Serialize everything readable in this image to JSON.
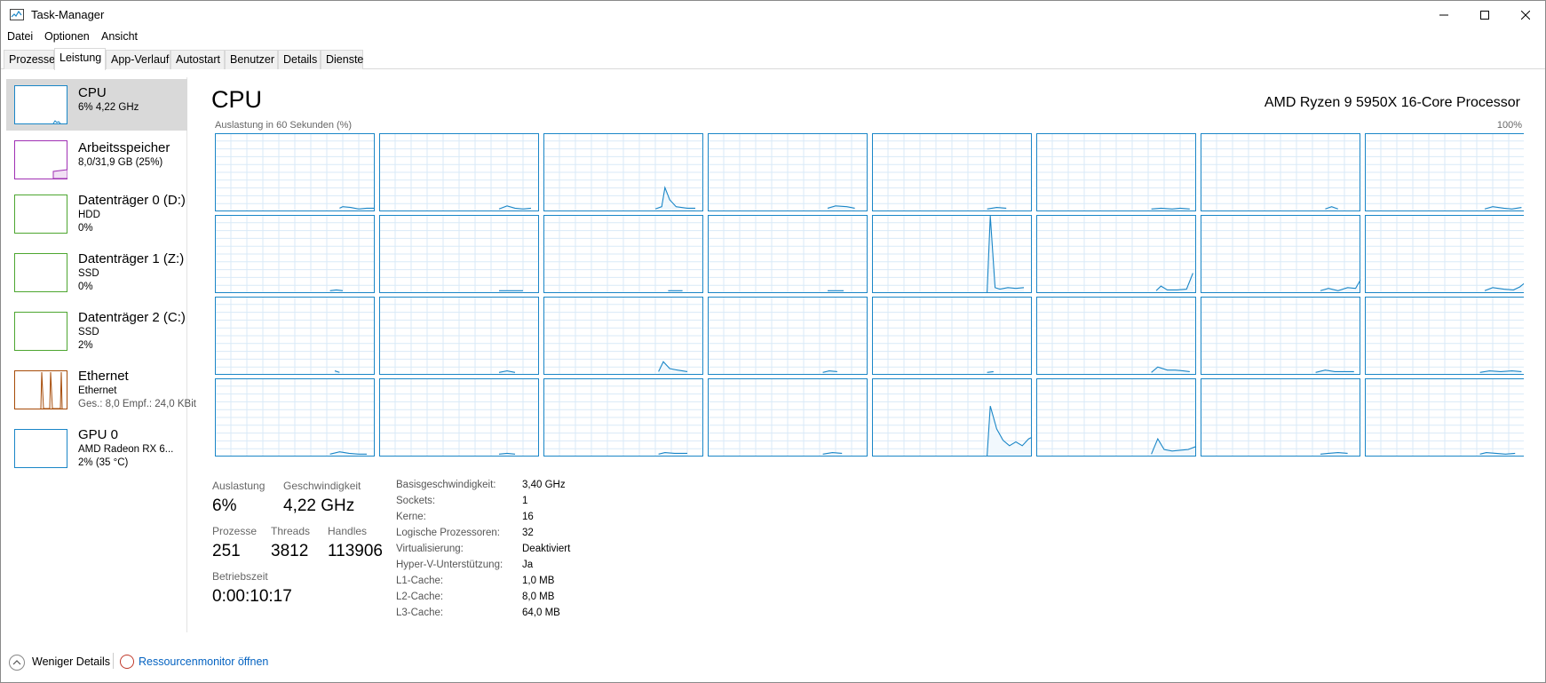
{
  "window": {
    "title": "Task-Manager"
  },
  "menu": {
    "items": [
      "Datei",
      "Optionen",
      "Ansicht"
    ]
  },
  "tabs": [
    {
      "label": "Prozesse",
      "active": false
    },
    {
      "label": "Leistung",
      "active": true
    },
    {
      "label": "App-Verlauf",
      "active": false
    },
    {
      "label": "Autostart",
      "active": false
    },
    {
      "label": "Benutzer",
      "active": false
    },
    {
      "label": "Details",
      "active": false
    },
    {
      "label": "Dienste",
      "active": false
    }
  ],
  "sidebar": {
    "items": [
      {
        "title": "CPU",
        "line1": "6% 4,22 GHz",
        "line2": "",
        "line3": "",
        "color": "#1a86c7",
        "selected": true
      },
      {
        "title": "Arbeitsspeicher",
        "line1": "8,0/31,9 GB (25%)",
        "line2": "",
        "line3": "",
        "color": "#a030b4",
        "selected": false
      },
      {
        "title": "Datenträger 0 (D:)",
        "line1": "HDD",
        "line2": "0%",
        "line3": "",
        "color": "#4da630",
        "selected": false
      },
      {
        "title": "Datenträger 1 (Z:)",
        "line1": "SSD",
        "line2": "0%",
        "line3": "",
        "color": "#4da630",
        "selected": false
      },
      {
        "title": "Datenträger 2 (C:)",
        "line1": "SSD",
        "line2": "2%",
        "line3": "",
        "color": "#4da630",
        "selected": false
      },
      {
        "title": "Ethernet",
        "line1": "Ethernet",
        "line2": "Ges.: 8,0  Empf.: 24,0 KBit",
        "line3": "",
        "color": "#a64b08",
        "selected": false
      },
      {
        "title": "GPU 0",
        "line1": "AMD Radeon RX 6...",
        "line2": "2% (35 °C)",
        "line3": "",
        "color": "#1a86c7",
        "selected": false
      }
    ]
  },
  "main": {
    "title": "CPU",
    "model": "AMD Ryzen 9 5950X 16-Core Processor",
    "graph_label": "Auslastung in 60 Sekunden (%)",
    "graph_max": "100%",
    "graph_color": "#1a86c7",
    "graph_grid_color": "#d9eaf7"
  },
  "stats": {
    "utilization_label": "Auslastung",
    "utilization_value": "6%",
    "speed_label": "Geschwindigkeit",
    "speed_value": "4,22 GHz",
    "processes_label": "Prozesse",
    "processes_value": "251",
    "threads_label": "Threads",
    "threads_value": "3812",
    "handles_label": "Handles",
    "handles_value": "113906",
    "uptime_label": "Betriebszeit",
    "uptime_value": "0:00:10:17"
  },
  "info": [
    {
      "label": "Basisgeschwindigkeit:",
      "value": "3,40 GHz"
    },
    {
      "label": "Sockets:",
      "value": "1"
    },
    {
      "label": "Kerne:",
      "value": "16"
    },
    {
      "label": "Logische Prozessoren:",
      "value": "32"
    },
    {
      "label": "Virtualisierung:",
      "value": "Deaktiviert"
    },
    {
      "label": "Hyper-V-Unterstützung:",
      "value": "Ja"
    },
    {
      "label": "L1-Cache:",
      "value": "1,0 MB"
    },
    {
      "label": "L2-Cache:",
      "value": "8,0 MB"
    },
    {
      "label": "L3-Cache:",
      "value": "64,0 MB"
    }
  ],
  "footer": {
    "fewer_details": "Weniger Details",
    "resmon": "Ressourcenmonitor öffnen"
  },
  "chart_data": {
    "type": "line",
    "ylim": [
      0,
      100
    ],
    "spikes": [
      [
        [
          0.78,
          3
        ],
        [
          0.8,
          5
        ],
        [
          0.85,
          4
        ],
        [
          0.9,
          2
        ],
        [
          0.95,
          3
        ],
        [
          1.0,
          3
        ]
      ],
      [
        [
          0.75,
          2
        ],
        [
          0.8,
          6
        ],
        [
          0.85,
          3
        ],
        [
          0.9,
          2
        ],
        [
          0.95,
          3
        ]
      ],
      [
        [
          0.7,
          2
        ],
        [
          0.74,
          5
        ],
        [
          0.76,
          30
        ],
        [
          0.79,
          14
        ],
        [
          0.83,
          5
        ],
        [
          0.9,
          3
        ],
        [
          0.95,
          3
        ]
      ],
      [
        [
          0.75,
          3
        ],
        [
          0.8,
          6
        ],
        [
          0.87,
          5
        ],
        [
          0.92,
          3
        ]
      ],
      [
        [
          0.72,
          2
        ],
        [
          0.78,
          4
        ],
        [
          0.84,
          3
        ]
      ],
      [
        [
          0.72,
          2
        ],
        [
          0.78,
          3
        ],
        [
          0.85,
          2
        ],
        [
          0.9,
          3
        ],
        [
          0.96,
          2
        ]
      ],
      [
        [
          0.78,
          2
        ],
        [
          0.82,
          5
        ],
        [
          0.86,
          2
        ]
      ],
      [
        [
          0.75,
          2
        ],
        [
          0.8,
          5
        ],
        [
          0.87,
          3
        ],
        [
          0.92,
          2
        ],
        [
          0.98,
          4
        ]
      ],
      [
        [
          0.72,
          2
        ],
        [
          0.76,
          3
        ],
        [
          0.8,
          2
        ]
      ],
      [
        [
          0.75,
          2
        ],
        [
          0.8,
          2
        ],
        [
          0.85,
          2
        ],
        [
          0.9,
          2
        ]
      ],
      [
        [
          0.78,
          2
        ],
        [
          0.83,
          2
        ],
        [
          0.87,
          2
        ]
      ],
      [
        [
          0.75,
          2
        ],
        [
          0.8,
          2
        ],
        [
          0.85,
          2
        ]
      ],
      [
        [
          0.72,
          0
        ],
        [
          0.74,
          100
        ],
        [
          0.77,
          6
        ],
        [
          0.8,
          4
        ],
        [
          0.85,
          6
        ],
        [
          0.9,
          5
        ],
        [
          0.95,
          6
        ]
      ],
      [
        [
          0.75,
          2
        ],
        [
          0.78,
          8
        ],
        [
          0.82,
          3
        ],
        [
          0.88,
          3
        ],
        [
          0.94,
          4
        ],
        [
          0.98,
          25
        ]
      ],
      [
        [
          0.75,
          2
        ],
        [
          0.8,
          5
        ],
        [
          0.86,
          2
        ],
        [
          0.92,
          6
        ],
        [
          0.97,
          5
        ],
        [
          1.0,
          16
        ]
      ],
      [
        [
          0.75,
          2
        ],
        [
          0.8,
          6
        ],
        [
          0.87,
          4
        ],
        [
          0.93,
          3
        ],
        [
          0.97,
          7
        ],
        [
          1.0,
          12
        ]
      ],
      [
        [
          0.75,
          4
        ],
        [
          0.78,
          2
        ]
      ],
      [
        [
          0.75,
          2
        ],
        [
          0.8,
          4
        ],
        [
          0.85,
          2
        ]
      ],
      [
        [
          0.72,
          3
        ],
        [
          0.75,
          16
        ],
        [
          0.79,
          7
        ],
        [
          0.84,
          5
        ],
        [
          0.9,
          3
        ]
      ],
      [
        [
          0.72,
          2
        ],
        [
          0.76,
          4
        ],
        [
          0.81,
          3
        ]
      ],
      [
        [
          0.72,
          2
        ],
        [
          0.76,
          3
        ]
      ],
      [
        [
          0.72,
          2
        ],
        [
          0.76,
          9
        ],
        [
          0.82,
          5
        ],
        [
          0.87,
          5
        ],
        [
          0.92,
          4
        ],
        [
          0.96,
          3
        ]
      ],
      [
        [
          0.72,
          2
        ],
        [
          0.78,
          5
        ],
        [
          0.84,
          3
        ],
        [
          0.9,
          3
        ],
        [
          0.96,
          3
        ]
      ],
      [
        [
          0.72,
          2
        ],
        [
          0.78,
          4
        ],
        [
          0.85,
          3
        ],
        [
          0.92,
          4
        ],
        [
          0.98,
          3
        ]
      ],
      [
        [
          0.72,
          2
        ],
        [
          0.78,
          5
        ],
        [
          0.84,
          3
        ],
        [
          0.9,
          2
        ],
        [
          0.95,
          2
        ]
      ],
      [
        [
          0.75,
          2
        ],
        [
          0.8,
          3
        ],
        [
          0.85,
          2
        ]
      ],
      [
        [
          0.72,
          2
        ],
        [
          0.76,
          4
        ],
        [
          0.82,
          3
        ],
        [
          0.9,
          3
        ]
      ],
      [
        [
          0.72,
          2
        ],
        [
          0.78,
          4
        ],
        [
          0.84,
          3
        ]
      ],
      [
        [
          0.72,
          0
        ],
        [
          0.74,
          65
        ],
        [
          0.78,
          35
        ],
        [
          0.82,
          20
        ],
        [
          0.86,
          13
        ],
        [
          0.9,
          18
        ],
        [
          0.94,
          13
        ],
        [
          0.98,
          22
        ],
        [
          1.0,
          24
        ]
      ],
      [
        [
          0.72,
          2
        ],
        [
          0.76,
          22
        ],
        [
          0.8,
          8
        ],
        [
          0.85,
          6
        ],
        [
          0.9,
          7
        ],
        [
          0.95,
          8
        ],
        [
          1.0,
          12
        ]
      ],
      [
        [
          0.75,
          2
        ],
        [
          0.8,
          3
        ],
        [
          0.86,
          4
        ],
        [
          0.92,
          3
        ]
      ],
      [
        [
          0.72,
          2
        ],
        [
          0.76,
          4
        ],
        [
          0.82,
          3
        ],
        [
          0.88,
          2
        ],
        [
          0.94,
          3
        ]
      ]
    ]
  }
}
